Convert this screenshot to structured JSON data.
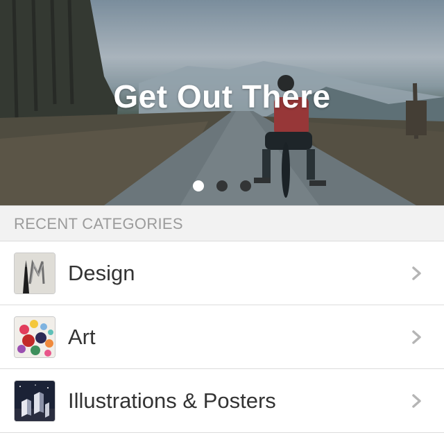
{
  "hero": {
    "title": "Get Out There",
    "page_count": 3,
    "active_page": 1
  },
  "section": {
    "title": "RECENT CATEGORIES"
  },
  "categories": [
    {
      "label": "Design",
      "icon": "design-thumbnail"
    },
    {
      "label": "Art",
      "icon": "art-thumbnail"
    },
    {
      "label": "Illustrations & Posters",
      "icon": "illustrations-thumbnail"
    }
  ],
  "colors": {
    "text_primary": "#333333",
    "section_text": "#9b9b9b",
    "section_bg": "#f2f2f2",
    "chevron": "#b5b5b5",
    "divider": "#dcdcdc"
  }
}
